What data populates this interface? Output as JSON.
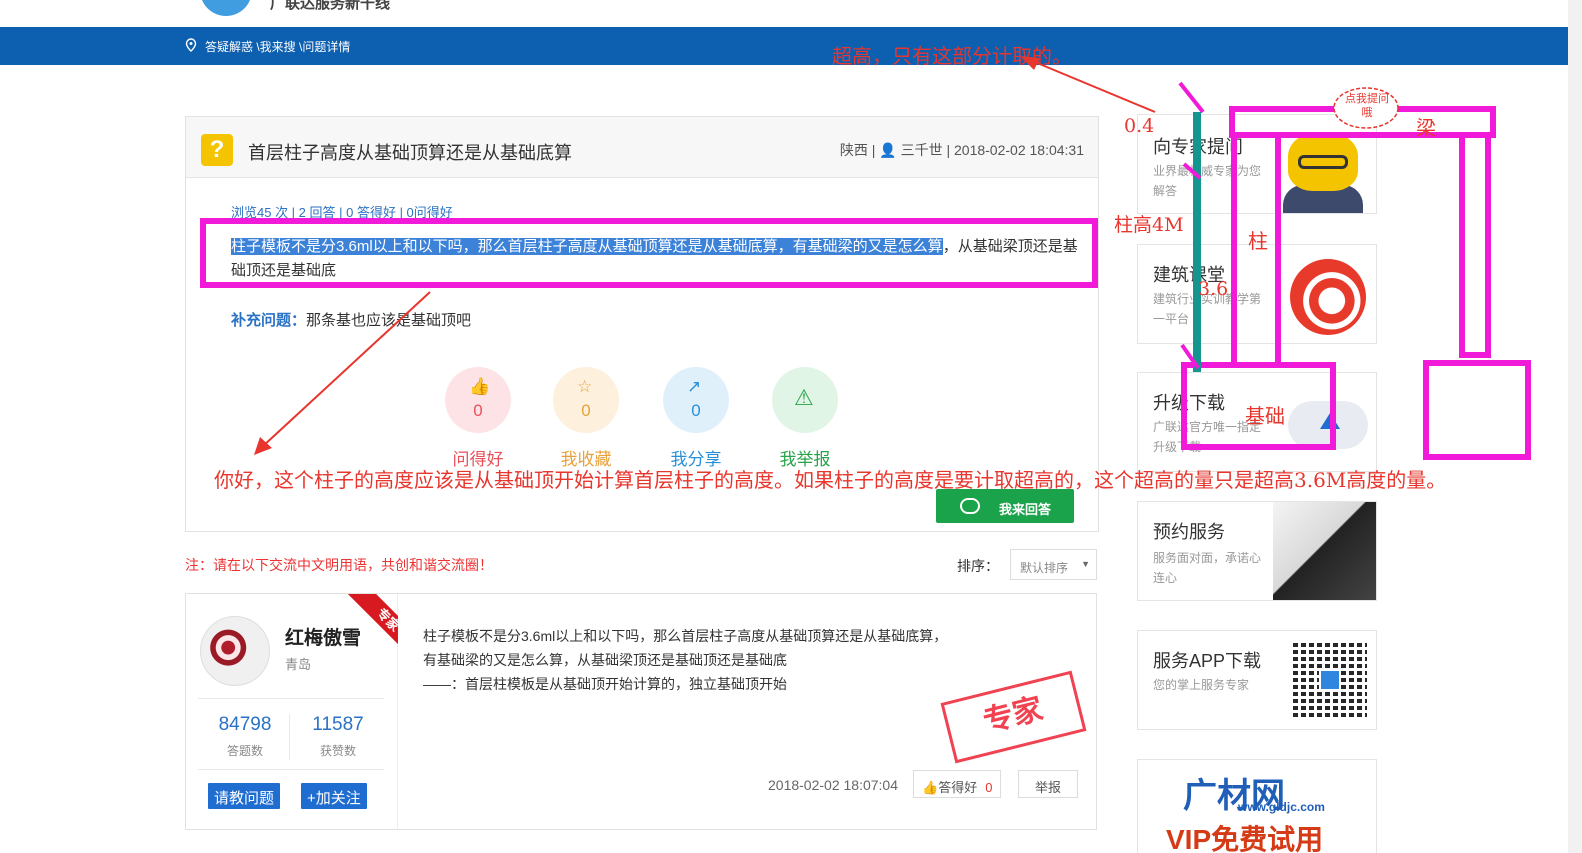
{
  "header": {
    "site_slogan": "广联达服务新干线",
    "breadcrumb": "答疑解惑 \\我来搜 \\问题详情"
  },
  "question": {
    "title": "首层柱子高度从基础顶算还是从基础底算",
    "meta": "陕西 | 👤 三千世 | 2018-02-02 18:04:31",
    "stats": "浏览45 次 | 2 回答 | 0 答得好 | 0问得好",
    "body_highlight": "柱子模板不是分3.6ml以上和以下吗，那么首层柱子高度从基础顶算还是从基础底算，有基础梁的又是怎么算",
    "body_rest": "，从基础梁顶还是基础顶还是基础底",
    "supplement_label": "补充问题：",
    "supplement_text": "那条基也应该是基础顶吧",
    "actions": [
      {
        "label": "问得好",
        "count": "0",
        "icon": "thumb-up-icon",
        "color": "#e8505b",
        "bg": "#fde3e5"
      },
      {
        "label": "我收藏",
        "count": "0",
        "icon": "star-icon",
        "color": "#e9a23b",
        "bg": "#fdf0dc"
      },
      {
        "label": "我分享",
        "count": "0",
        "icon": "share-icon",
        "color": "#2a8fd8",
        "bg": "#dff0fb"
      },
      {
        "label": "我举报",
        "count": "",
        "icon": "warning-icon",
        "color": "#2aa34a",
        "bg": "#e1f5e6"
      }
    ],
    "answer_button": "我来回答"
  },
  "notice": "注：请在以下交流中文明用语，共创和谐交流圈！",
  "sort": {
    "label": "排序：",
    "selected": "默认排序"
  },
  "answer": {
    "name": "红梅傲雪",
    "location": "青岛",
    "badge": "专家",
    "answers_count": "84798",
    "answers_label": "答题数",
    "likes_count": "11587",
    "likes_label": "获赞数",
    "ask_button": "请教问题",
    "follow_button": "+加关注",
    "text_line1": "柱子模板不是分3.6ml以上和以下吗，那么首层柱子高度从基础顶算还是从基础底算，",
    "text_line2": "有基础梁的又是怎么算，从基础梁顶还是基础顶还是基础底",
    "text_line3": "——：首层柱模板是从基础顶开始计算的，独立基础顶开始",
    "stamp": "专家",
    "date": "2018-02-02 18:07:04",
    "good_label": "答得好",
    "good_count": "0",
    "report_label": "举报"
  },
  "sidebar": [
    {
      "title": "向专家提问",
      "desc": "业界最权威专家为您解答"
    },
    {
      "title": "建筑课堂",
      "desc": "建筑行业实训教学第一平台"
    },
    {
      "title": "升级下载",
      "desc": "广联达官方唯一指定升级下载"
    },
    {
      "title": "预约服务",
      "desc": "服务面对面，承诺心连心"
    },
    {
      "title": "服务APP下载",
      "desc": "您的掌上服务专家"
    },
    {
      "logo": "广材网",
      "url": "www.gldjc.com",
      "promo": "VIP免费试用"
    }
  ],
  "annotations": {
    "top_note": "超高，只有这部分计取的。",
    "dim_04": "0.4",
    "col_height": "柱高4M",
    "dim_36": "3.6",
    "column": "柱",
    "beam": "梁",
    "foundation": "基础",
    "cloud_text": "点我提问哦",
    "reply": "你好，这个柱子的高度应该是从基础顶开始计算首层柱子的高度。如果柱子的高度是要计取超高的，这个超高的量只是超高3.6M高度的量。",
    "reply_line2": "高度的量。",
    "mark_color": "#f01ad8",
    "teal_color": "#12968f"
  }
}
